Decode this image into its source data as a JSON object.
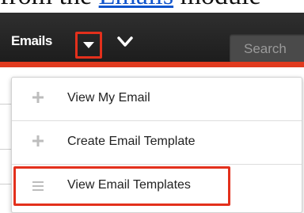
{
  "doc": {
    "prefix": "from the ",
    "link": "Emails",
    "suffix": " module"
  },
  "navbar": {
    "module_label": "Emails",
    "search_placeholder": "Search"
  },
  "menu": {
    "items": [
      {
        "label": "View My Email",
        "icon": "plus-icon"
      },
      {
        "label": "Create Email Template",
        "icon": "plus-icon"
      },
      {
        "label": "View Email Templates",
        "icon": "list-icon"
      }
    ]
  },
  "colors": {
    "navbar_bg": "#262626",
    "accent_red": "#e03a1e",
    "highlight_red": "#e3301c"
  }
}
